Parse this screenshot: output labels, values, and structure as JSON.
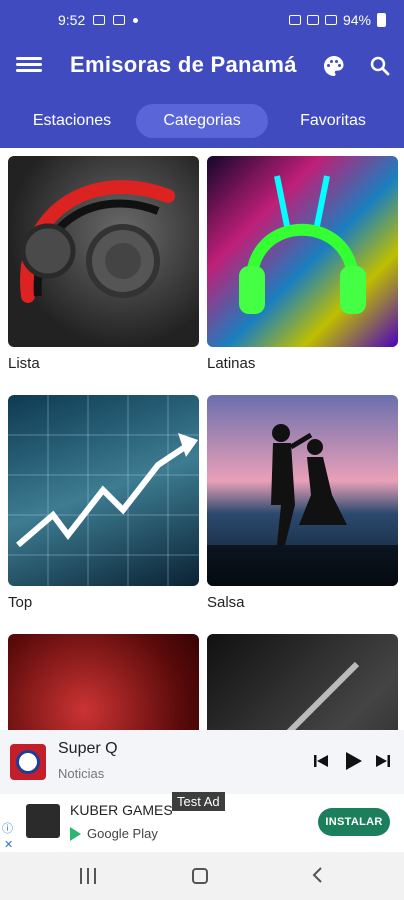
{
  "status": {
    "time": "9:52",
    "battery": "94%"
  },
  "appbar": {
    "title": "Emisoras de Panamá",
    "menu_icon": "menu-icon",
    "palette_icon": "palette-icon",
    "search_icon": "search-icon"
  },
  "tabs": [
    {
      "label": "Estaciones",
      "active": false
    },
    {
      "label": "Categorias",
      "active": true
    },
    {
      "label": "Favoritas",
      "active": false
    }
  ],
  "categories": [
    {
      "label": "Lista"
    },
    {
      "label": "Latinas"
    },
    {
      "label": "Top"
    },
    {
      "label": "Salsa"
    },
    {
      "label": ""
    },
    {
      "label": ""
    }
  ],
  "player": {
    "title": "Super Q",
    "subtitle": "Noticias"
  },
  "ad": {
    "app_name": "KUBER GAMES",
    "store": "Google Play",
    "test_label": "Test Ad",
    "install_label": "INSTALAR"
  },
  "colors": {
    "primary": "#3f4bbf",
    "tab_active": "#5a66d8",
    "install": "#1c7f5c"
  }
}
